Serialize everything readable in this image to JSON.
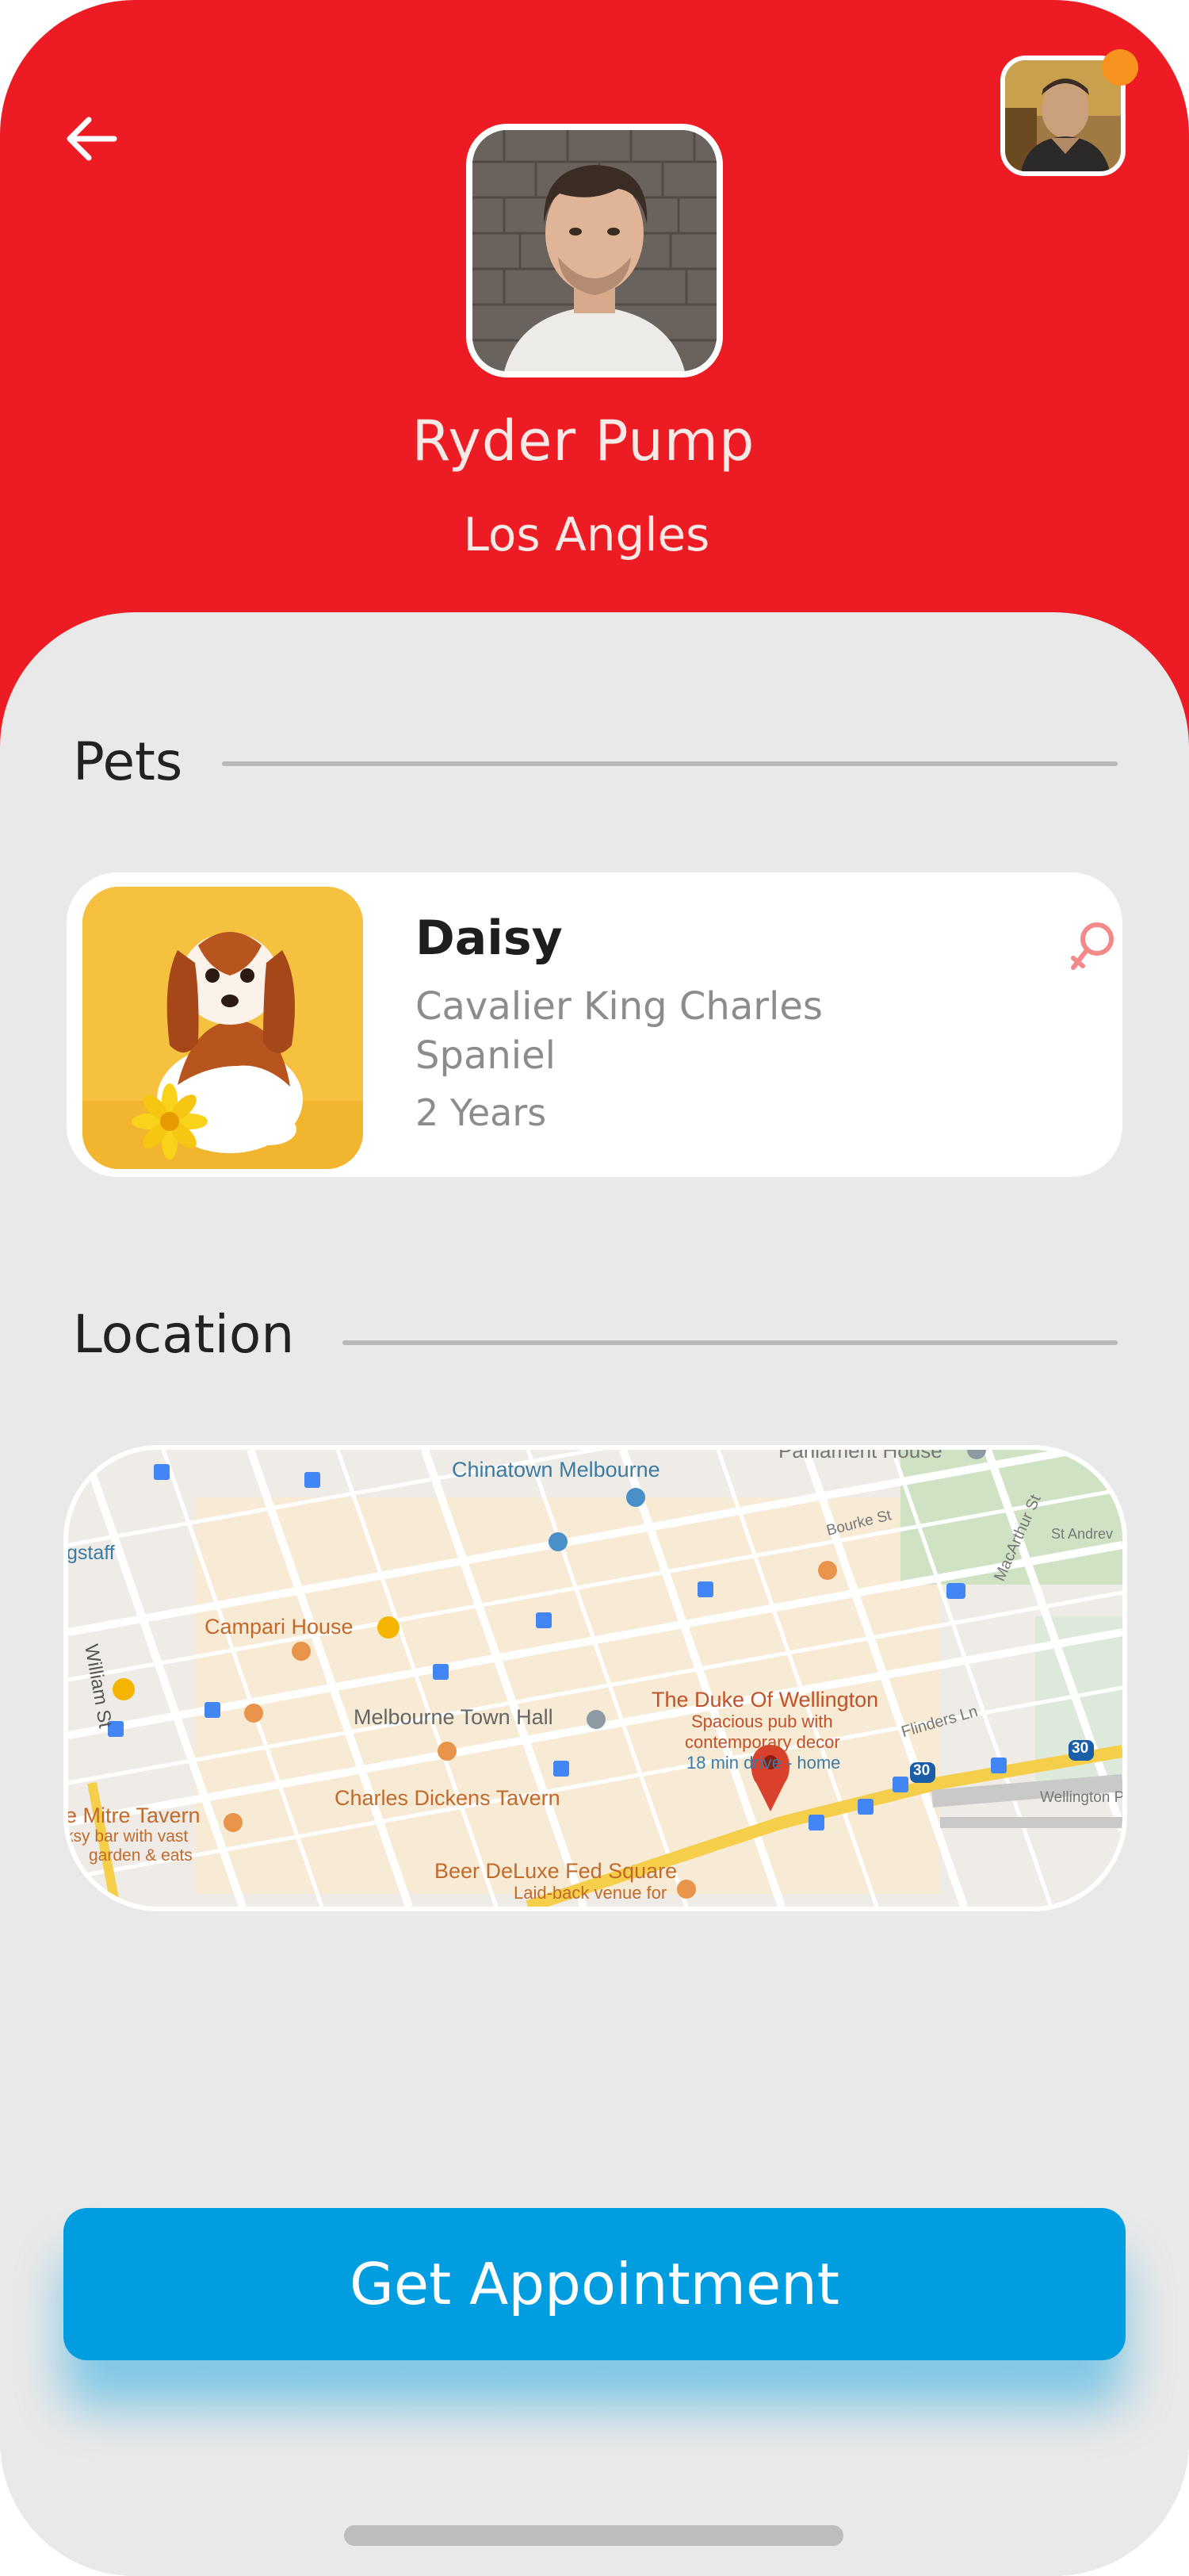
{
  "profile": {
    "name": "Ryder Pump",
    "city": "Los Angles"
  },
  "sections": {
    "pets_title": "Pets",
    "location_title": "Location"
  },
  "pet": {
    "name": "Daisy",
    "breed": "Cavalier King Charles Spaniel",
    "age": "2 Years",
    "gender_icon": "female-icon"
  },
  "map": {
    "labels": {
      "chinatown": "Chinatown Melbourne",
      "parliament": "Parliament House",
      "bourke": "Bourke St",
      "macarthur": "MacArthur St",
      "st_andrews": "St Andrev",
      "staff": "gstaff",
      "campari": "Campari House",
      "william": "William St",
      "town_hall": "Melbourne Town Hall",
      "duke": "The Duke Of Wellington",
      "duke_desc1": "Spacious pub with",
      "duke_desc2": "contemporary decor",
      "duke_drive": "18 min drive - home",
      "flinders": "Flinders Ln",
      "wellington": "Wellington P",
      "mitre": "e Mitre Tavern",
      "mitre_desc1": "ksy bar with vast",
      "mitre_desc2": "garden & eats",
      "dickens": "Charles Dickens Tavern",
      "beer": "Beer DeLuxe Fed Square",
      "beer_desc": "Laid-back venue for",
      "route30a": "30",
      "route30b": "30"
    }
  },
  "cta": {
    "label": "Get Appointment"
  },
  "colors": {
    "header": "#ed1c24",
    "cta": "#009ee0",
    "background": "#e9e9e9",
    "badge": "#f7931e"
  }
}
